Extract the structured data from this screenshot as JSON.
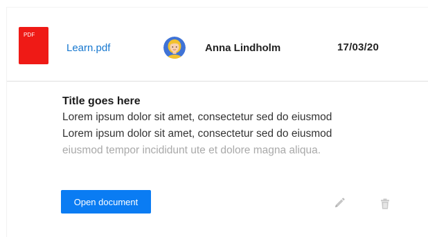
{
  "file_row": {
    "file_type_badge": "PDF",
    "file_name": "Learn.pdf",
    "owner_name": "Anna Lindholm",
    "date": "17/03/20"
  },
  "details": {
    "title": "Title goes here",
    "description_lines": [
      "Lorem ipsum dolor sit amet, consectetur sed do eiusmod",
      "Lorem ipsum dolor sit amet, consectetur sed do eiusmod",
      "eiusmod tempor incididunt ute et dolore magna aliqua."
    ]
  },
  "actions": {
    "open_button_label": "Open document",
    "edit_icon": "pencil-icon",
    "delete_icon": "trash-icon"
  },
  "colors": {
    "link": "#1677cf",
    "primary_button": "#0a7cf3",
    "pdf_badge": "#ef1a16",
    "faded_text": "#a9a9a9"
  }
}
